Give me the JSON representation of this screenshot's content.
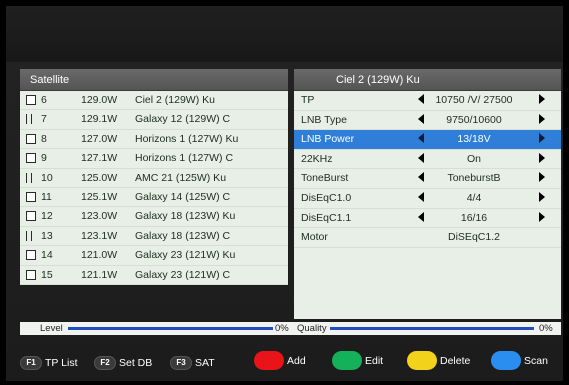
{
  "left_panel": {
    "header": "Satellite",
    "rows": [
      {
        "num": "6",
        "pos": "129.0W",
        "name": "Ciel 2 (129W) Ku",
        "mark": "box"
      },
      {
        "num": "7",
        "pos": "129.1W",
        "name": "Galaxy 12 (129W) C",
        "mark": "bar"
      },
      {
        "num": "8",
        "pos": "127.0W",
        "name": "Horizons 1 (127W) Ku",
        "mark": "box"
      },
      {
        "num": "9",
        "pos": "127.1W",
        "name": "Horizons 1 (127W) C",
        "mark": "box"
      },
      {
        "num": "10",
        "pos": "125.0W",
        "name": "AMC 21 (125W) Ku",
        "mark": "bar"
      },
      {
        "num": "11",
        "pos": "125.1W",
        "name": "Galaxy 14 (125W) C",
        "mark": "box"
      },
      {
        "num": "12",
        "pos": "123.0W",
        "name": "Galaxy 18 (123W) Ku",
        "mark": "box"
      },
      {
        "num": "13",
        "pos": "123.1W",
        "name": "Galaxy 18 (123W) C",
        "mark": "bar"
      },
      {
        "num": "14",
        "pos": "121.0W",
        "name": "Galaxy 23 (121W) Ku",
        "mark": "box"
      },
      {
        "num": "15",
        "pos": "121.1W",
        "name": "Galaxy 23 (121W) C",
        "mark": "box"
      }
    ]
  },
  "right_panel": {
    "header": "Ciel 2 (129W) Ku",
    "params": [
      {
        "label": "TP",
        "value": "10750 /V/ 27500",
        "arrows": true
      },
      {
        "label": "LNB Type",
        "value": "9750/10600",
        "arrows": true
      },
      {
        "label": "LNB Power",
        "value": "13/18V",
        "arrows": true,
        "selected": true
      },
      {
        "label": "22KHz",
        "value": "On",
        "arrows": true
      },
      {
        "label": "ToneBurst",
        "value": "ToneburstB",
        "arrows": true
      },
      {
        "label": "DisEqC1.0",
        "value": "4/4",
        "arrows": true
      },
      {
        "label": "DisEqC1.1",
        "value": "16/16",
        "arrows": true
      },
      {
        "label": "Motor",
        "value": "DiSEqC1.2",
        "arrows": false
      }
    ]
  },
  "signal": {
    "level_label": "Level",
    "level_value": "0%",
    "quality_label": "Quality",
    "quality_value": "0%"
  },
  "function_keys": {
    "f1": {
      "key": "F1",
      "label": "TP List"
    },
    "f2": {
      "key": "F2",
      "label": "Set DB"
    },
    "f3": {
      "key": "F3",
      "label": "SAT"
    },
    "red": {
      "label": "Add",
      "color": "#e8141a"
    },
    "green": {
      "label": "Edit",
      "color": "#14b05a"
    },
    "yellow": {
      "label": "Delete",
      "color": "#f2d21a"
    },
    "blue": {
      "label": "Scan",
      "color": "#2a8ef0"
    }
  }
}
